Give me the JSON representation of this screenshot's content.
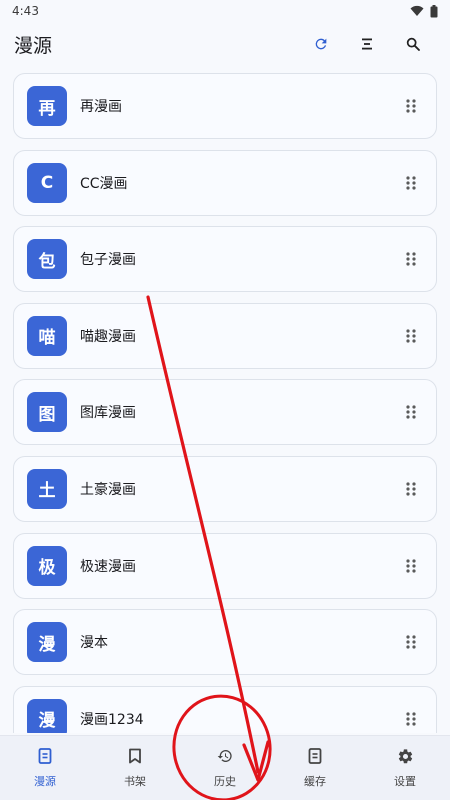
{
  "status_bar": {
    "time": "4:43"
  },
  "header": {
    "title": "漫源",
    "actions": [
      "refresh-icon",
      "sort-icon",
      "search-icon"
    ]
  },
  "sources": [
    {
      "avatar": "再",
      "label": "再漫画"
    },
    {
      "avatar": "C",
      "label": "CC漫画"
    },
    {
      "avatar": "包",
      "label": "包子漫画"
    },
    {
      "avatar": "喵",
      "label": "喵趣漫画"
    },
    {
      "avatar": "图",
      "label": "图库漫画"
    },
    {
      "avatar": "土",
      "label": "土豪漫画"
    },
    {
      "avatar": "极",
      "label": "极速漫画"
    },
    {
      "avatar": "漫",
      "label": "漫本"
    },
    {
      "avatar": "漫",
      "label": "漫画1234"
    }
  ],
  "bottom_nav": [
    {
      "label": "漫源",
      "icon": "book-icon",
      "active": true
    },
    {
      "label": "书架",
      "icon": "bookmark-icon",
      "active": false
    },
    {
      "label": "历史",
      "icon": "history-icon",
      "active": false
    },
    {
      "label": "缓存",
      "icon": "download-icon",
      "active": false
    },
    {
      "label": "设置",
      "icon": "gear-icon",
      "active": false
    }
  ],
  "colors": {
    "accent": "#2f5fd1",
    "avatar_bg": "#3b66d6",
    "annotation": "#e0141a"
  }
}
